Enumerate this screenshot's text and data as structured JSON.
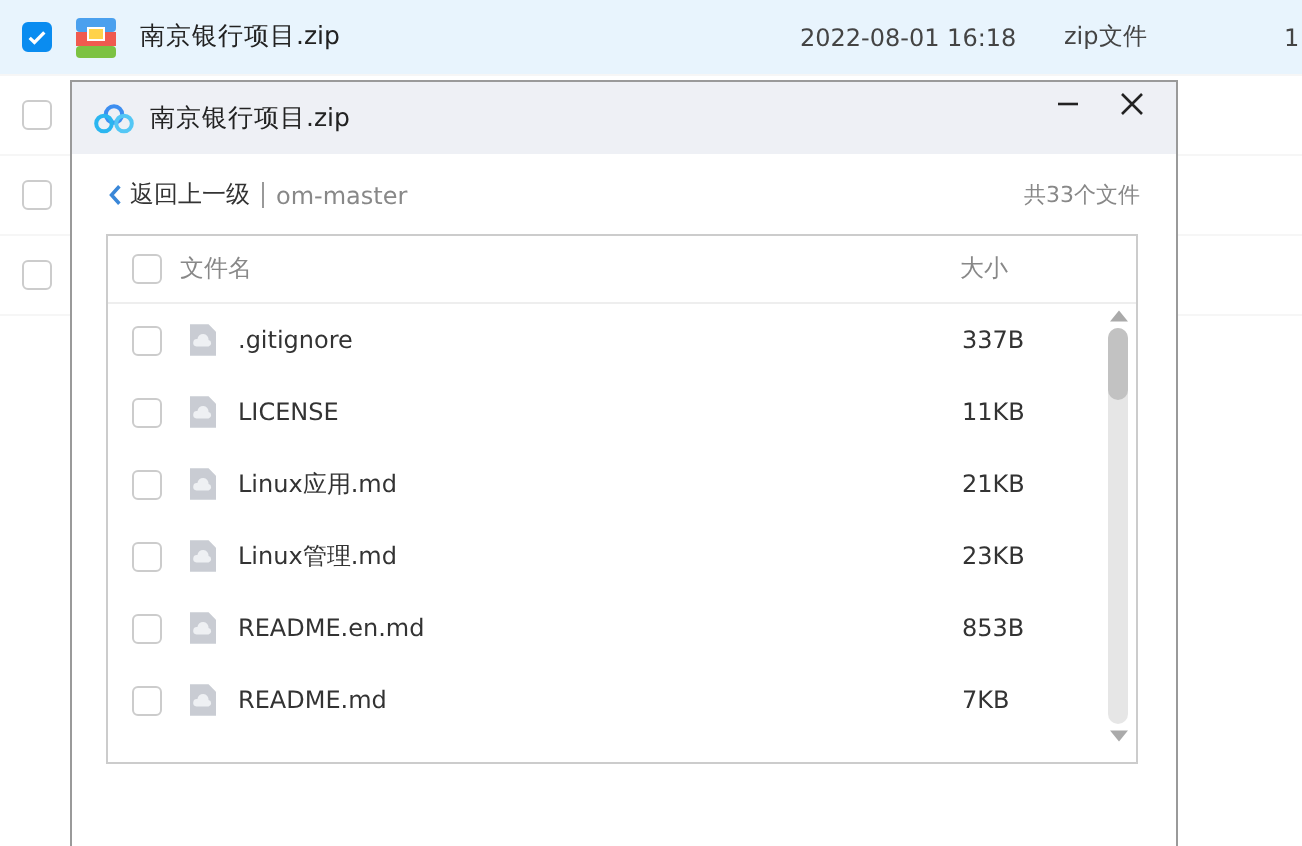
{
  "background_list": {
    "rows": [
      {
        "selected": true,
        "checked": true,
        "name": "南京银行项目.zip",
        "date": "2022-08-01 16:18",
        "type": "zip文件",
        "column_5": "1"
      },
      {
        "selected": false,
        "checked": false
      },
      {
        "selected": false,
        "checked": false
      },
      {
        "selected": false,
        "checked": false
      }
    ]
  },
  "dialog": {
    "title": "南京银行项目.zip",
    "back_link": "返回上一级",
    "folder": "om-master",
    "file_count": "共33个文件",
    "table": {
      "columns": [
        "文件名",
        "大小"
      ],
      "header_checked": false,
      "rows": [
        {
          "name": ".gitignore",
          "size": "337B",
          "checked": false
        },
        {
          "name": "LICENSE",
          "size": "11KB",
          "checked": false
        },
        {
          "name": "Linux应用.md",
          "size": "21KB",
          "checked": false
        },
        {
          "name": "Linux管理.md",
          "size": "23KB",
          "checked": false
        },
        {
          "name": "README.en.md",
          "size": "853B",
          "checked": false
        },
        {
          "name": "README.md",
          "size": "7KB",
          "checked": false
        }
      ]
    }
  }
}
